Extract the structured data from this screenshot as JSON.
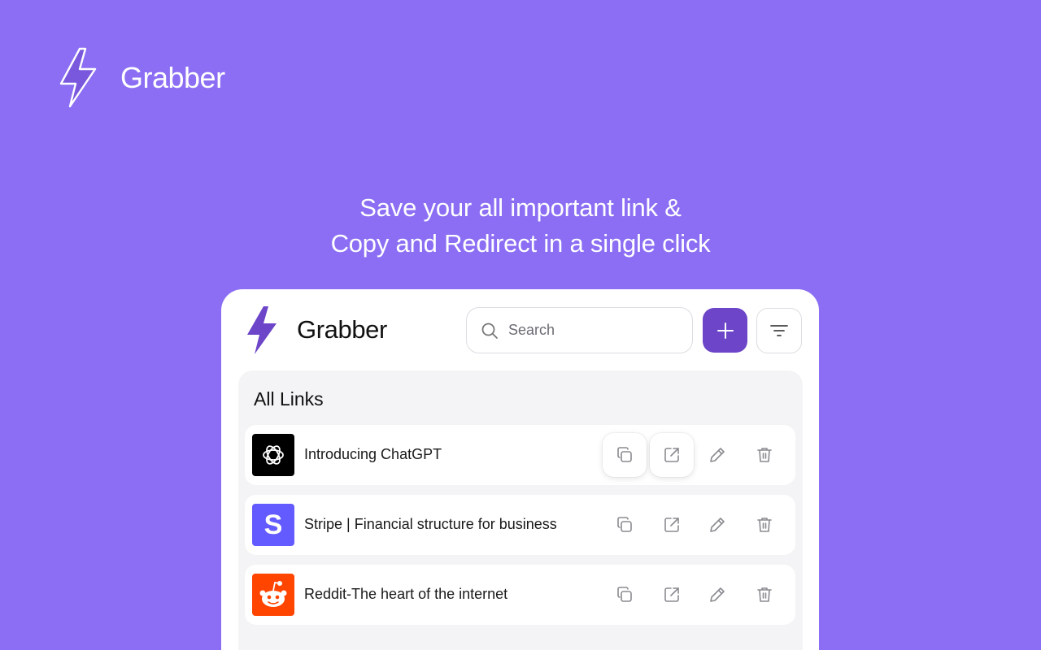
{
  "brand": {
    "name": "Grabber"
  },
  "headline": {
    "line1": "Save your all important link &",
    "line2": "Copy and Redirect in a single click"
  },
  "popup": {
    "app_name": "Grabber",
    "search": {
      "placeholder": "Search",
      "value": ""
    },
    "add_button_icon": "plus-icon",
    "filter_button_icon": "filter-icon",
    "section_title": "All Links",
    "links": [
      {
        "title": "Introducing ChatGPT",
        "favicon": "openai-logo"
      },
      {
        "title": "Stripe | Financial structure for business",
        "favicon": "stripe-logo",
        "favicon_letter": "S"
      },
      {
        "title": "Reddit-The heart of the internet",
        "favicon": "reddit-logo"
      }
    ],
    "row_actions": [
      "copy-icon",
      "external-link-icon",
      "pencil-icon",
      "trash-icon"
    ]
  },
  "colors": {
    "background": "#8b6ef3",
    "accent": "#6c45c8",
    "stripe": "#635bff",
    "reddit": "#ff4500"
  }
}
